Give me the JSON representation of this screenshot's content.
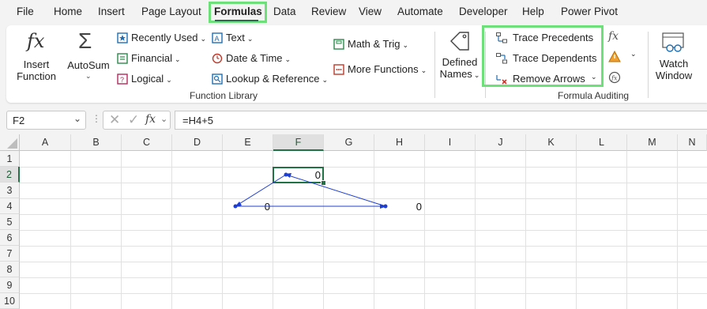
{
  "menu": {
    "tabs": [
      "File",
      "Home",
      "Insert",
      "Page Layout",
      "Formulas",
      "Data",
      "Review",
      "View",
      "Automate",
      "Developer",
      "Help",
      "Power Pivot"
    ],
    "active": "Formulas"
  },
  "ribbon": {
    "insert_function": {
      "line1": "Insert",
      "line2": "Function",
      "glyph": "fx"
    },
    "autosum": {
      "label": "AutoSum",
      "glyph": "Σ"
    },
    "recently_used": "Recently Used",
    "financial": "Financial",
    "logical": "Logical",
    "text": "Text",
    "date_time": "Date & Time",
    "lookup_reference": "Lookup & Reference",
    "math_trig": "Math & Trig",
    "more_functions": "More Functions",
    "function_library_label": "Function Library",
    "defined_names": {
      "line1": "Defined",
      "line2": "Names"
    },
    "trace_precedents": "Trace Precedents",
    "trace_dependents": "Trace Dependents",
    "remove_arrows": "Remove Arrows",
    "formula_auditing_label": "Formula Auditing",
    "watch_window": {
      "line1": "Watch",
      "line2": "Window"
    },
    "accent_color": "#6ee07a"
  },
  "formula_bar": {
    "name_box": "F2",
    "fx_glyph": "fx",
    "formula": "=H4+5"
  },
  "sheet": {
    "columns": [
      "A",
      "B",
      "C",
      "D",
      "E",
      "F",
      "G",
      "H",
      "I",
      "J",
      "K",
      "L",
      "M",
      "N"
    ],
    "rows": [
      "1",
      "2",
      "3",
      "4",
      "5",
      "6",
      "7",
      "8",
      "9",
      "10"
    ],
    "selected_cell": "F2",
    "cells": {
      "F2": "0",
      "E4": "0",
      "H4": "0"
    },
    "arrow_color": "#1f3fd1",
    "selection_color": "#217346"
  }
}
